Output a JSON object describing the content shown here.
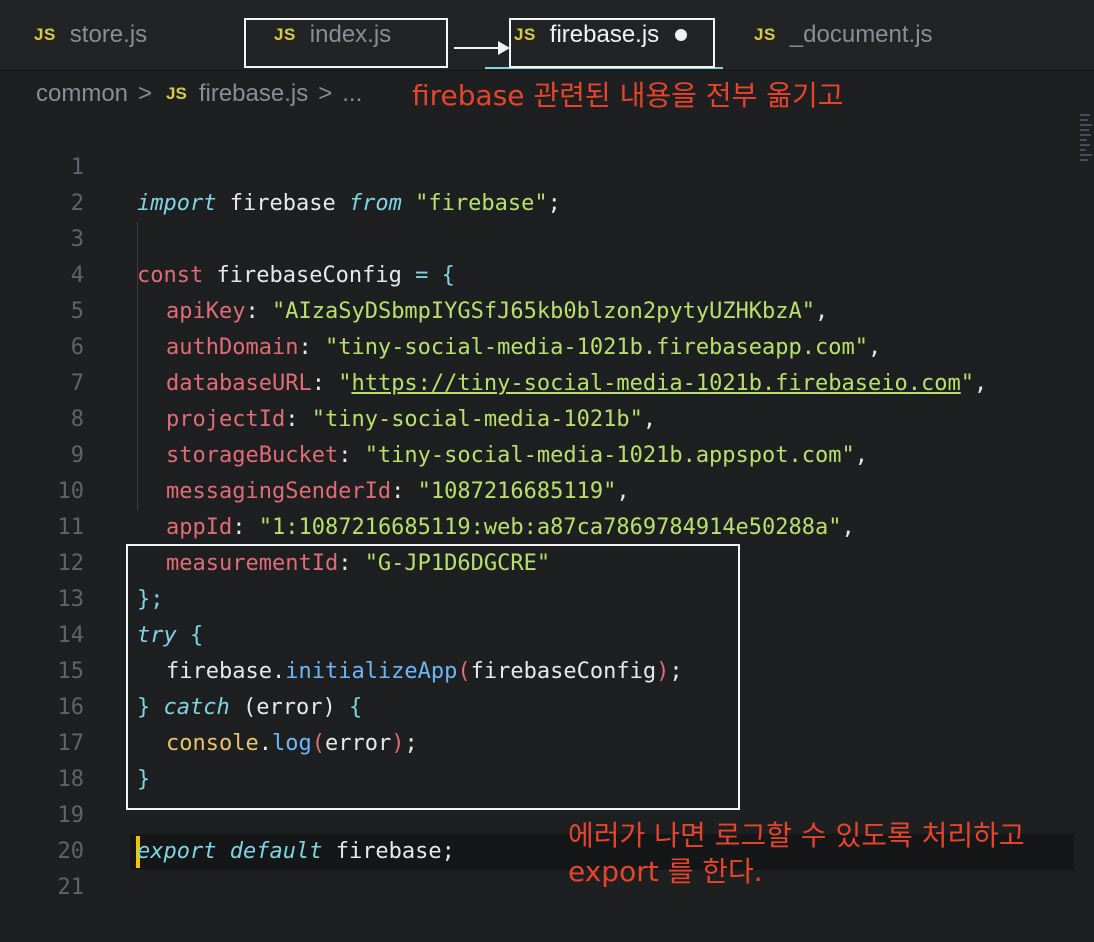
{
  "tabs": [
    {
      "icon": "JS",
      "label": "store.js"
    },
    {
      "icon": "JS",
      "label": "index.js"
    },
    {
      "icon": "JS",
      "label": "firebase.js"
    },
    {
      "icon": "JS",
      "label": "_document.js"
    }
  ],
  "breadcrumb": {
    "folder": "common",
    "sep1": ">",
    "file_icon": "JS",
    "file": "firebase.js",
    "sep2": ">",
    "more": "..."
  },
  "annotations": {
    "move_note": "firebase 관련된 내용을 전부 옮기고",
    "error_note_line1": "에러가 나면 로그할 수 있도록 처리하고",
    "error_note_line2": "export 를 한다."
  },
  "line_numbers": [
    "1",
    "2",
    "3",
    "4",
    "5",
    "6",
    "7",
    "8",
    "9",
    "10",
    "11",
    "12",
    "13",
    "14",
    "15",
    "16",
    "17",
    "18",
    "19",
    "20",
    "21"
  ],
  "code": {
    "l1": {
      "kw1": "import",
      "id": " firebase ",
      "kw2": "from",
      "sp": " ",
      "str": "\"firebase\"",
      "end": ";"
    },
    "l3": {
      "kw": "const",
      "id": " firebaseConfig ",
      "op": "= {"
    },
    "l4": {
      "key": "apiKey",
      "colon": ": ",
      "val": "\"AIzaSyDSbmpIYGSfJ65kb0blzon2pytyUZHKbzA\"",
      "end": ","
    },
    "l5": {
      "key": "authDomain",
      "colon": ": ",
      "val": "\"tiny-social-media-1021b.firebaseapp.com\"",
      "end": ","
    },
    "l6": {
      "key": "databaseURL",
      "colon": ": ",
      "q1": "\"",
      "val": "https://tiny-social-media-1021b.firebaseio.com",
      "q2": "\"",
      "end": ","
    },
    "l7": {
      "key": "projectId",
      "colon": ": ",
      "val": "\"tiny-social-media-1021b\"",
      "end": ","
    },
    "l8": {
      "key": "storageBucket",
      "colon": ": ",
      "val": "\"tiny-social-media-1021b.appspot.com\"",
      "end": ","
    },
    "l9": {
      "key": "messagingSenderId",
      "colon": ": ",
      "val": "\"1087216685119\"",
      "end": ","
    },
    "l10": {
      "key": "appId",
      "colon": ": ",
      "val": "\"1:1087216685119:web:a87ca7869784914e50288a\"",
      "end": ","
    },
    "l11": {
      "key": "measurementId",
      "colon": ": ",
      "val": "\"G-JP1D6DGCRE\""
    },
    "l12": {
      "text": "};"
    },
    "l13": {
      "kw": "try",
      "brace": " {"
    },
    "l14": {
      "obj": "firebase",
      "dot": ".",
      "fn": "initializeApp",
      "p1": "(",
      "arg": "firebaseConfig",
      "p2": ")",
      "end": ";"
    },
    "l15": {
      "b1": "}",
      "sp": " ",
      "kw": "catch",
      "rest": " (error) ",
      "b2": "{"
    },
    "l16": {
      "obj": "console",
      "dot": ".",
      "fn": "log",
      "p1": "(",
      "arg": "error",
      "p2": ")",
      "end": ";"
    },
    "l17": {
      "text": "}"
    },
    "l19": {
      "kw1": "export",
      "sp": " ",
      "kw2": "default",
      "id": " firebase;"
    }
  },
  "colors": {
    "background": "#1e1f21",
    "annotation": "#e7452b",
    "cursor": "#f0c400",
    "string": "#b8e06c",
    "keyword": "#e06c75",
    "italic_keyword": "#7fd4e4",
    "function": "#6cb6f5"
  }
}
